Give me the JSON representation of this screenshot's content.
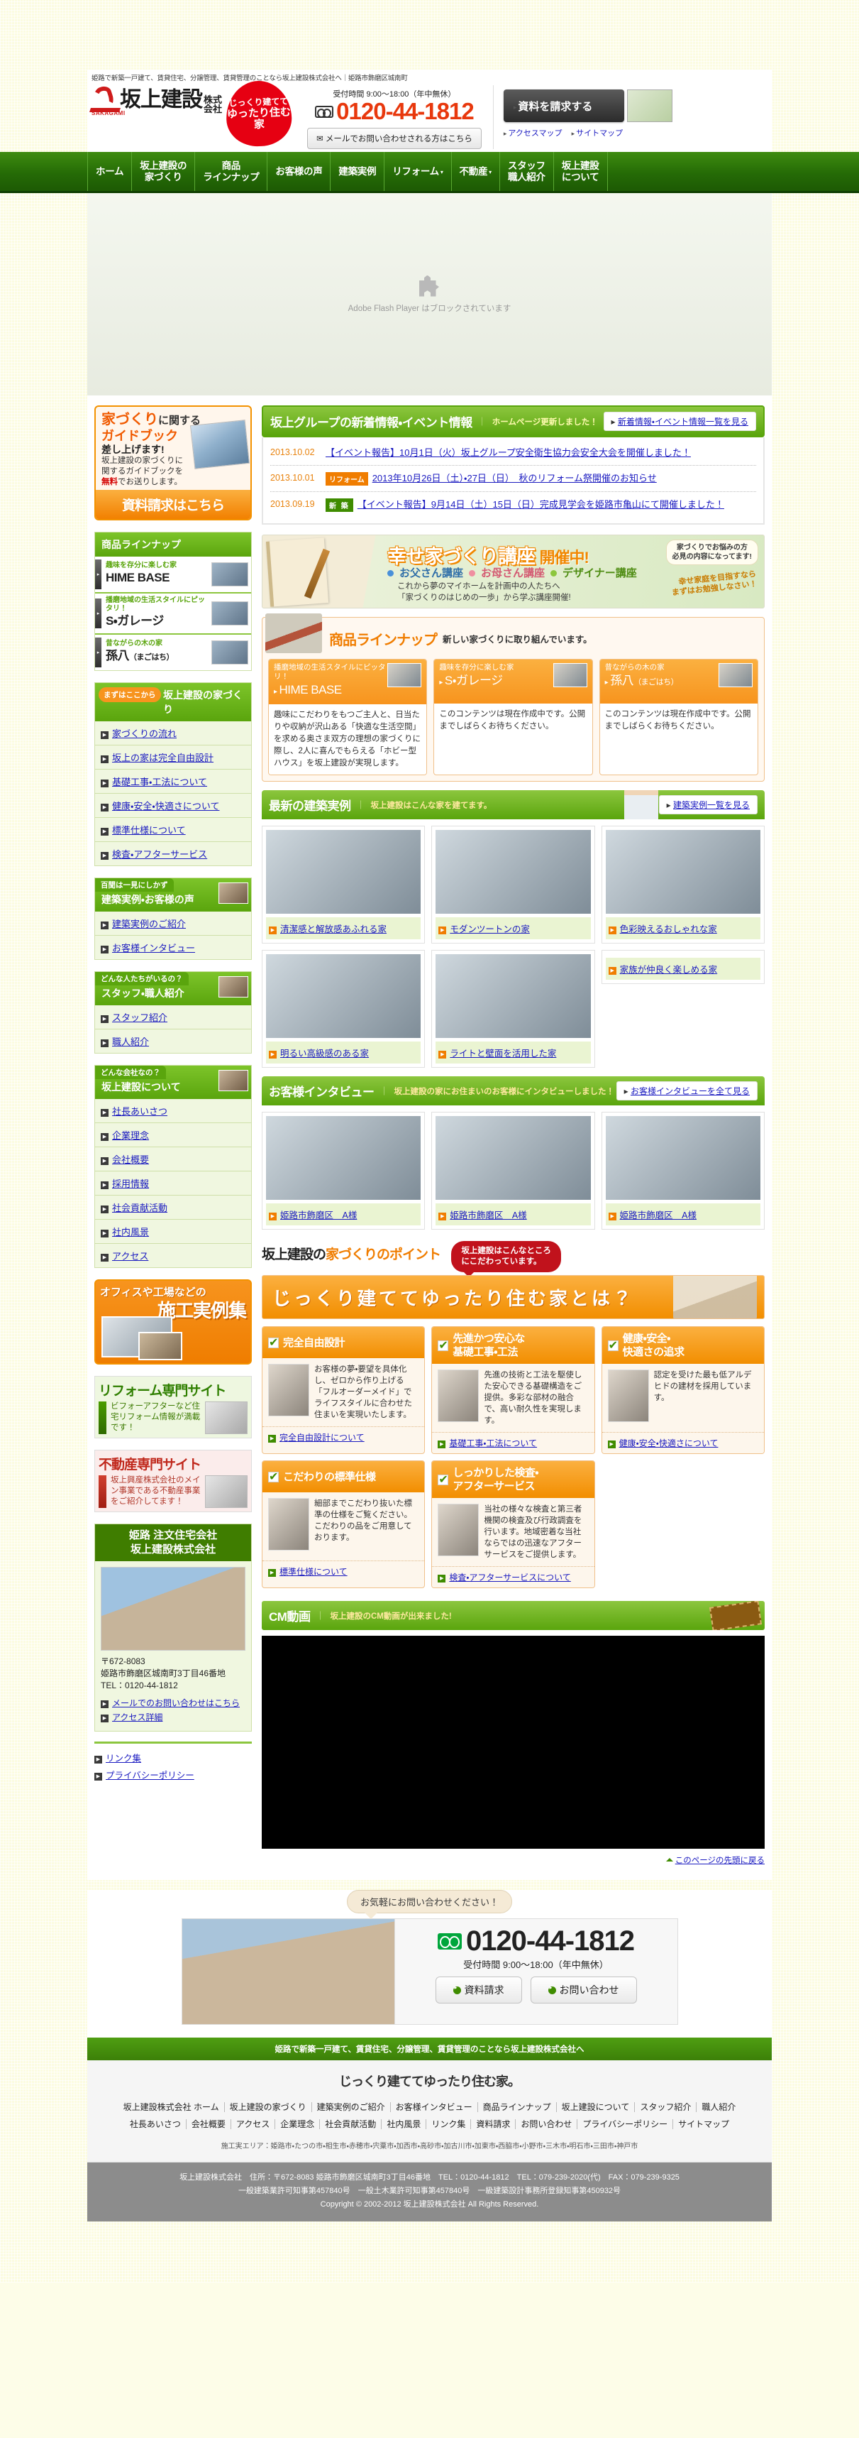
{
  "header": {
    "tagline": "姫路で新築一戸建て、賃貸住宅、分譲管理、賃貸管理のことなら坂上建設株式会社へ｜姫路市飾磨区城南町",
    "company_name": "坂上建設",
    "company_suffix_1": "株式",
    "company_suffix_2": "会社",
    "logo_mark_text": "SAKAGAMI",
    "seal_line1": "じっくり建てて",
    "seal_line2": "ゆったり住む",
    "seal_line3": "家",
    "hours": "受付時間 9:00～18:00（年中無休）",
    "phone": "0120-44-1812",
    "mail_button": "メールでお問い合わせされる方はこちら",
    "request_button": "資料を請求する",
    "access_map": "アクセスマップ",
    "sitemap": "サイトマップ"
  },
  "nav": {
    "items": [
      {
        "label": "ホーム",
        "dropdown": false
      },
      {
        "label": "坂上建設の\n家づくり",
        "dropdown": false
      },
      {
        "label": "商品\nラインナップ",
        "dropdown": false
      },
      {
        "label": "お客様の声",
        "dropdown": false
      },
      {
        "label": "建築実例",
        "dropdown": false
      },
      {
        "label": "リフォーム",
        "dropdown": true
      },
      {
        "label": "不動産",
        "dropdown": true
      },
      {
        "label": "スタッフ\n職人紹介",
        "dropdown": false
      },
      {
        "label": "坂上建設\nについて",
        "dropdown": false
      }
    ]
  },
  "flash": {
    "message": "Adobe Flash Player はブロックされています"
  },
  "sidebar": {
    "guidebook": {
      "title_big": "家づくり",
      "title_small": "に関する",
      "title_2": "ガイドブック",
      "title_3": "差し上げます!",
      "desc_1": "坂上建設の家づくりに",
      "desc_2": "関するガイドブックを",
      "desc_free": "無料",
      "desc_3": "でお送りします。",
      "cta": "資料請求はこちら"
    },
    "lineup": {
      "heading": "商品ラインナップ",
      "items": [
        {
          "sub": "趣味を存分に楽しむ家",
          "name": "HIME BASE",
          "paren": ""
        },
        {
          "sub": "播磨地域の生活スタイルにピッタリ！",
          "name": "S・ガレージ",
          "paren": ""
        },
        {
          "sub": "昔ながらの木の家",
          "name": "孫八",
          "paren": "（まごはち）"
        }
      ]
    },
    "groups": [
      {
        "badge": "まずはここから",
        "heading": "坂上建設の家づくり",
        "style": "badge",
        "links": [
          "家づくりの流れ",
          "坂上の家は完全自由設計",
          "基礎工事・工法について",
          "健康・安全・快適さについて",
          "標準仕様について",
          "検査・アフターサービス"
        ]
      },
      {
        "badge": "百聞は一見にしかず",
        "heading": "建築実例・お客様の声",
        "style": "tab",
        "links": [
          "建築実例のご紹介",
          "お客様インタビュー"
        ]
      },
      {
        "badge": "どんな人たちがいるの？",
        "heading": "スタッフ・職人紹介",
        "style": "tab",
        "links": [
          "スタッフ紹介",
          "職人紹介"
        ]
      },
      {
        "badge": "どんな会社なの？",
        "heading": "坂上建設について",
        "style": "tab",
        "links": [
          "社長あいさつ",
          "企業理念",
          "会社概要",
          "採用情報",
          "社会貢献活動",
          "社内風景",
          "アクセス"
        ]
      }
    ],
    "sekou_banner": {
      "line1": "オフィスや工場などの",
      "line2": "施工実例集"
    },
    "reform_site": {
      "title": "リフォーム専門サイト",
      "desc": "ビフォーアフターなど住宅リフォーム情報が満載です！"
    },
    "estate_site": {
      "title": "不動産専門サイト",
      "desc": "坂上興産株式会社のメイン事業である不動産事業をご紹介してます！"
    },
    "office": {
      "head_line1": "姫路 注文住宅会社",
      "head_line2": "坂上建設株式会社",
      "zip": "〒672-8083",
      "address": "姫路市飾磨区城南町3丁目46番地",
      "tel": "TEL：0120-44-1812",
      "links": [
        "メールでのお問い合わせはこちら",
        "アクセス詳細"
      ]
    },
    "bottom_links": [
      "リンク集",
      "プライバシーポリシー"
    ]
  },
  "news": {
    "title": "坂上グループの新着情報・イベント情報",
    "subtitle": "ホームページ更新しました！",
    "more": "新着情報・イベント情報一覧を見る",
    "rows": [
      {
        "date": "2013.10.02",
        "tag": "",
        "tag_type": "",
        "text": "【イベント報告】10月1日（火）坂上グループ安全衛生協力会安全大会を開催しました！"
      },
      {
        "date": "2013.10.01",
        "tag": "リフォーム",
        "tag_type": "reform",
        "text": "2013年10月26日（土）・27日（日）　秋のリフォーム祭開催のお知らせ"
      },
      {
        "date": "2013.09.19",
        "tag": "新 築",
        "tag_type": "new",
        "text": "【イベント報告】9月14日（土）15日（日）完成見学会を姫路市亀山にて開催しました！"
      }
    ]
  },
  "kouza": {
    "title_main": "幸せ家づくり講座",
    "title_sub": "開催中!",
    "courses": [
      "お父さん講座",
      "お母さん講座",
      "デザイナー講座"
    ],
    "desc_1": "これから夢のマイホームを計画中の人たちへ",
    "desc_2": "「家づくりのはじめの一歩」から学ぶ講座開催!",
    "bubble_1": "家づくりでお悩みの方",
    "bubble_2": "必見の内容になってます!",
    "hand_1": "幸せ家庭を目指すなら",
    "hand_2": "まずはお勉強しなさい！"
  },
  "lineup_section": {
    "title": "商品ラインナップ",
    "subtitle": "新しい家づくりに取り組んでいます。",
    "cards": [
      {
        "sub": "播磨地域の生活スタイルにピッタリ！",
        "name": "HIME BASE",
        "paren": "",
        "body": "趣味にこだわりをもつご主人と、日当たりや収納が沢山ある「快適な生活空間」を求める奥さま双方の理想の家づくりに際し、2人に喜んでもらえる「ホビー型ハウス」を坂上建設が実現します。"
      },
      {
        "sub": "趣味を存分に楽しむ家",
        "name": "S・ガレージ",
        "paren": "",
        "body": "このコンテンツは現在作成中です。公開までしばらくお待ちください。"
      },
      {
        "sub": "昔ながらの木の家",
        "name": "孫八",
        "paren": "（まごはち）",
        "body": "このコンテンツは現在作成中です。公開までしばらくお待ちください。"
      }
    ]
  },
  "works": {
    "title": "最新の建築実例",
    "subtitle": "坂上建設はこんな家を建てます。",
    "more": "建築実例一覧を見る",
    "items": [
      {
        "caption": "清潔感と解放感あふれる家",
        "has_image": true
      },
      {
        "caption": "モダンツートンの家",
        "has_image": true
      },
      {
        "caption": "色彩映えるおしゃれな家",
        "has_image": true
      },
      {
        "caption": "明るい高級感のある家",
        "has_image": true
      },
      {
        "caption": "ライトと壁面を活用した家",
        "has_image": true
      },
      {
        "caption": "家族が仲良く楽しめる家",
        "has_image": false
      }
    ]
  },
  "interviews": {
    "title": "お客様インタビュー",
    "subtitle": "坂上建設の家にお住まいのお客様にインタビューしました！",
    "more": "お客様インタビューを全て見る",
    "items": [
      {
        "caption": "姫路市飾磨区　A様"
      },
      {
        "caption": "姫路市飾磨区　A様"
      },
      {
        "caption": "姫路市飾磨区　A様"
      }
    ]
  },
  "points": {
    "title_1": "坂上建設の",
    "title_2": "家づくりのポイント",
    "bubble_1": "坂上建設はこんなところ",
    "bubble_2": "にこだわっています。",
    "banner": "じっくり建ててゆったり住む家とは？",
    "cards": [
      {
        "heading": "完全自由設計",
        "body": "お客様の夢・要望を具体化し、ゼロから作り上げる「フルオーダーメイド」でライフスタイルに合わせた住まいを実現いたします。",
        "link": "完全自由設計について"
      },
      {
        "heading": "先進かつ安心な\n基礎工事・工法",
        "body": "先進の技術と工法を駆使した安心できる基礎構造をご提供。多彩な部材の融合で、高い耐久性を実現します。",
        "link": "基礎工事・工法について"
      },
      {
        "heading": "健康・安全・\n快適さの追求",
        "body": "認定を受けた最も低アルデヒドの建材を採用しています。",
        "link": "健康・安全・快適さについて"
      },
      {
        "heading": "こだわりの標準仕様",
        "body": "細部までこだわり抜いた標準の仕様をご覧ください。こだわりの品をご用意しております。",
        "link": "標準仕様について"
      },
      {
        "heading": "しっかりした検査・\nアフターサービス",
        "body": "当社の様々な検査と第三者機関の検査及び行政調査を行います。地域密着な当社ならではの迅速なアフターサービスをご提供します。",
        "link": "検査・アフターサービスについて"
      }
    ]
  },
  "cm": {
    "title": "CM動画",
    "subtitle": "坂上建設のCM動画が出来ました!",
    "back_to_top": "このページの先頭に戻る"
  },
  "contact": {
    "bubble": "お気軽にお問い合わせください！",
    "phone": "0120-44-1812",
    "hours": "受付時間 9:00～18:00（年中無休）",
    "btn_request": "資料請求",
    "btn_contact": "お問い合わせ"
  },
  "footer": {
    "green_bar": "姫路で新築一戸建て、賃貸住宅、分譲管理、賃貸管理のことなら坂上建設株式会社へ",
    "slogan": "じっくり建ててゆったり住む家。",
    "links_row1": [
      "坂上建設株式会社 ホーム",
      "坂上建設の家づくり",
      "建築実例のご紹介",
      "お客様インタビュー",
      "商品ラインナップ",
      "坂上建設について",
      "スタッフ紹介",
      "職人紹介"
    ],
    "links_row2": [
      "社長あいさつ",
      "会社概要",
      "アクセス",
      "企業理念",
      "社会貢献活動",
      "社内風景",
      "リンク集",
      "資料請求",
      "お問い合わせ",
      "プライバシーポリシー",
      "サイトマップ"
    ],
    "area": "施工実エリア：姫路市・たつの市・相生市・赤穂市・宍粟市・加西市・高砂市・加古川市・加東市・西脇市・小野市・三木市・明石市・三田市・神戸市",
    "copy_line1": "坂上建設株式会社　住所：〒672-8083 姫路市飾磨区城南町3丁目46番地　TEL：0120-44-1812　TEL：079-239-2020(代)　FAX：079-239-9325",
    "copy_line2": "一般建築業許可知事第457840号　一般土木業許可知事第457840号　一級建築設計事務所登録知事第450932号",
    "copy_line3": "Copyright © 2002-2012 坂上建設株式会社 All Rights Reserved."
  }
}
